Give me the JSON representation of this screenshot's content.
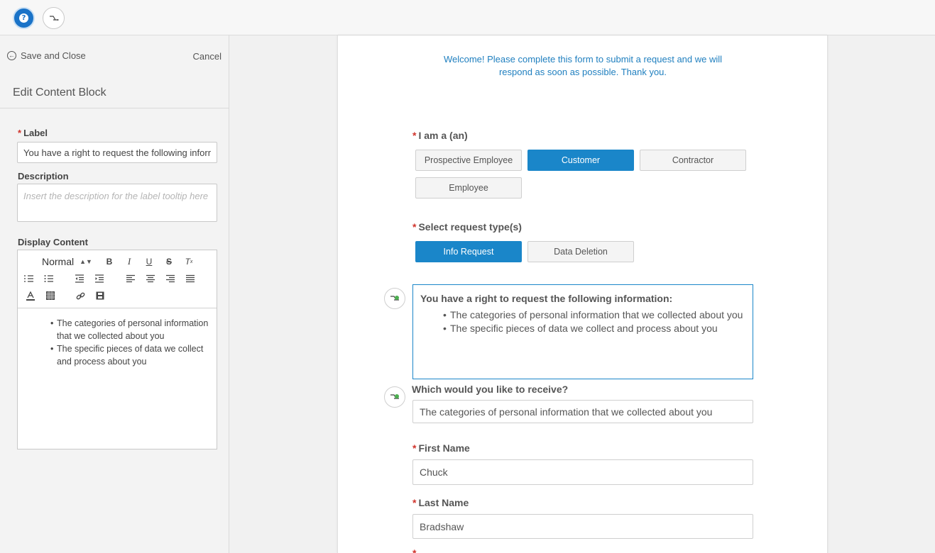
{
  "topbar": {
    "help_icon_label": "?",
    "icons": [
      "help-icon",
      "workflow-icon"
    ]
  },
  "left_panel": {
    "save_close_label": "Save and Close",
    "cancel_label": "Cancel",
    "title": "Edit Content Block",
    "label_field": {
      "label": "Label",
      "value": "You have a right to request the following information:"
    },
    "description_field": {
      "label": "Description",
      "placeholder": "Insert the description for the label tooltip here"
    },
    "display_content": {
      "label": "Display Content",
      "format_select": "Normal",
      "toolbar_icons": [
        "bold-icon",
        "italic-icon",
        "underline-icon",
        "strikethrough-icon",
        "clear-format-icon",
        "ordered-list-icon",
        "bullet-list-icon",
        "outdent-icon",
        "indent-icon",
        "align-left-icon",
        "align-center-icon",
        "align-right-icon",
        "align-justify-icon",
        "text-color-icon",
        "background-color-icon",
        "link-icon",
        "video-icon"
      ],
      "items": [
        "The categories of personal information that we collected about you",
        "The specific pieces of data we collect and process about you"
      ]
    }
  },
  "form": {
    "welcome_line1": "Welcome! Please complete this form to submit a request and we will",
    "welcome_line2": "respond as soon as possible. Thank you.",
    "iam": {
      "label": "I am a (an)",
      "options": [
        "Prospective Employee",
        "Customer",
        "Contractor",
        "Employee"
      ],
      "selected": "Customer"
    },
    "request_type": {
      "label": "Select request type(s)",
      "options": [
        "Info Request",
        "Data Deletion"
      ],
      "selected": "Info Request"
    },
    "content_block": {
      "title": "You have a right to request the following information:",
      "items": [
        "The categories of personal information that we collected about you",
        "The specific pieces of data we collect and process about you"
      ]
    },
    "receive": {
      "label": "Which would you like to receive?",
      "value": "The categories of personal information that we collected about you"
    },
    "first_name": {
      "label": "First Name",
      "value": "Chuck"
    },
    "last_name": {
      "label": "Last Name",
      "value": "Bradshaw"
    }
  },
  "colors": {
    "accent": "#1a86c9",
    "required": "#d0342c",
    "welcome_text": "#1f7fbf"
  }
}
